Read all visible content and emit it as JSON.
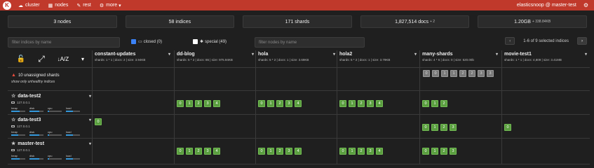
{
  "nav": {
    "logo": "K",
    "items": [
      {
        "icon": "☁",
        "label": "cluster"
      },
      {
        "icon": "▦",
        "label": "nodes"
      },
      {
        "icon": "✎",
        "label": "rest"
      },
      {
        "icon": "⚙",
        "label": "more",
        "caret": "▾"
      }
    ],
    "user": "elasticsnoop @ master-test",
    "gear": "⚙"
  },
  "stats": {
    "nodes": "3 nodes",
    "indices": "58 indices",
    "shards": "171 shards",
    "docs": "1,827,514",
    "docs_suffix": "docs",
    "docs_small": "+ 2",
    "size": "1.20GB",
    "size_small": "+ 338.84KB"
  },
  "filters": {
    "indices_placeholder": "filter indices by name",
    "closed_label": "closed (0)",
    "special_label": "special (49)",
    "nodes_placeholder": "filter nodes by name",
    "pager_text": "1-6 of 9 selected indices",
    "prev": "‹",
    "next": "›"
  },
  "controls": {
    "lock": "🔓",
    "expand": "⤢",
    "sort": "↓A/Z",
    "caret": "▾"
  },
  "indices": [
    {
      "name": "constant-updates",
      "meta": "shards: 1 * 1 | docs: 2 | size: 3.94KB"
    },
    {
      "name": "dd-blog",
      "meta": "shards: 5 * 2 | docs: 86 | size: 975.94KB"
    },
    {
      "name": "hola",
      "meta": "shards: 5 * 2 | docs: 1 | size: 3.69KB"
    },
    {
      "name": "hola2",
      "meta": "shards: 5 * 2 | docs: 1 | size: 3.79KB"
    },
    {
      "name": "many-shards",
      "meta": "shards: 4 * 6 | docs: 0 | size: 520.00b"
    },
    {
      "name": "movie-test1",
      "meta": "shards: 1 * 1 | docs: 4,809 | size: 3.41MB"
    }
  ],
  "unassigned": {
    "label": "10 unassigned shards",
    "toggle": "show only unhealthy indices",
    "shards": [
      "0",
      "0",
      "1",
      "1",
      "2",
      "2",
      "3",
      "3"
    ]
  },
  "nodes": [
    {
      "name": "data-test2",
      "ip": "127.0.0.1",
      "master": false,
      "metrics": [
        {
          "label": "heap",
          "fill": 0.6
        },
        {
          "label": "disk",
          "fill": 0.7
        },
        {
          "label": "cpu",
          "fill": 0.1
        },
        {
          "label": "load",
          "fill": 0.5
        }
      ],
      "shards": [
        [],
        [
          "0",
          "1",
          "2",
          "3",
          "4"
        ],
        [
          "0",
          "1",
          "2",
          "3",
          "4"
        ],
        [
          "0",
          "1",
          "2",
          "3",
          "4"
        ],
        [
          "0",
          "1",
          "2"
        ],
        []
      ]
    },
    {
      "name": "data-test3",
      "ip": "127.0.0.1",
      "master": false,
      "metrics": [
        {
          "label": "heap",
          "fill": 0.5
        },
        {
          "label": "disk",
          "fill": 0.7
        },
        {
          "label": "cpu",
          "fill": 0.1
        },
        {
          "label": "load",
          "fill": 0.5
        }
      ],
      "shards": [
        [
          "0"
        ],
        [],
        [],
        [],
        [
          "0",
          "1",
          "2",
          "3"
        ],
        [
          "0"
        ]
      ]
    },
    {
      "name": "master-test",
      "ip": "127.0.0.1",
      "master": true,
      "metrics": [
        {
          "label": "heap",
          "fill": 0.6
        },
        {
          "label": "disk",
          "fill": 0.7
        },
        {
          "label": "cpu",
          "fill": 0.1
        },
        {
          "label": "load",
          "fill": 0.5
        }
      ],
      "shards": [
        [],
        [
          "0",
          "1",
          "2",
          "3",
          "4"
        ],
        [
          "0",
          "1",
          "2",
          "3",
          "4"
        ],
        [
          "0",
          "1",
          "2",
          "3",
          "4"
        ],
        [
          "0",
          "1",
          "2",
          "3"
        ],
        []
      ]
    }
  ]
}
